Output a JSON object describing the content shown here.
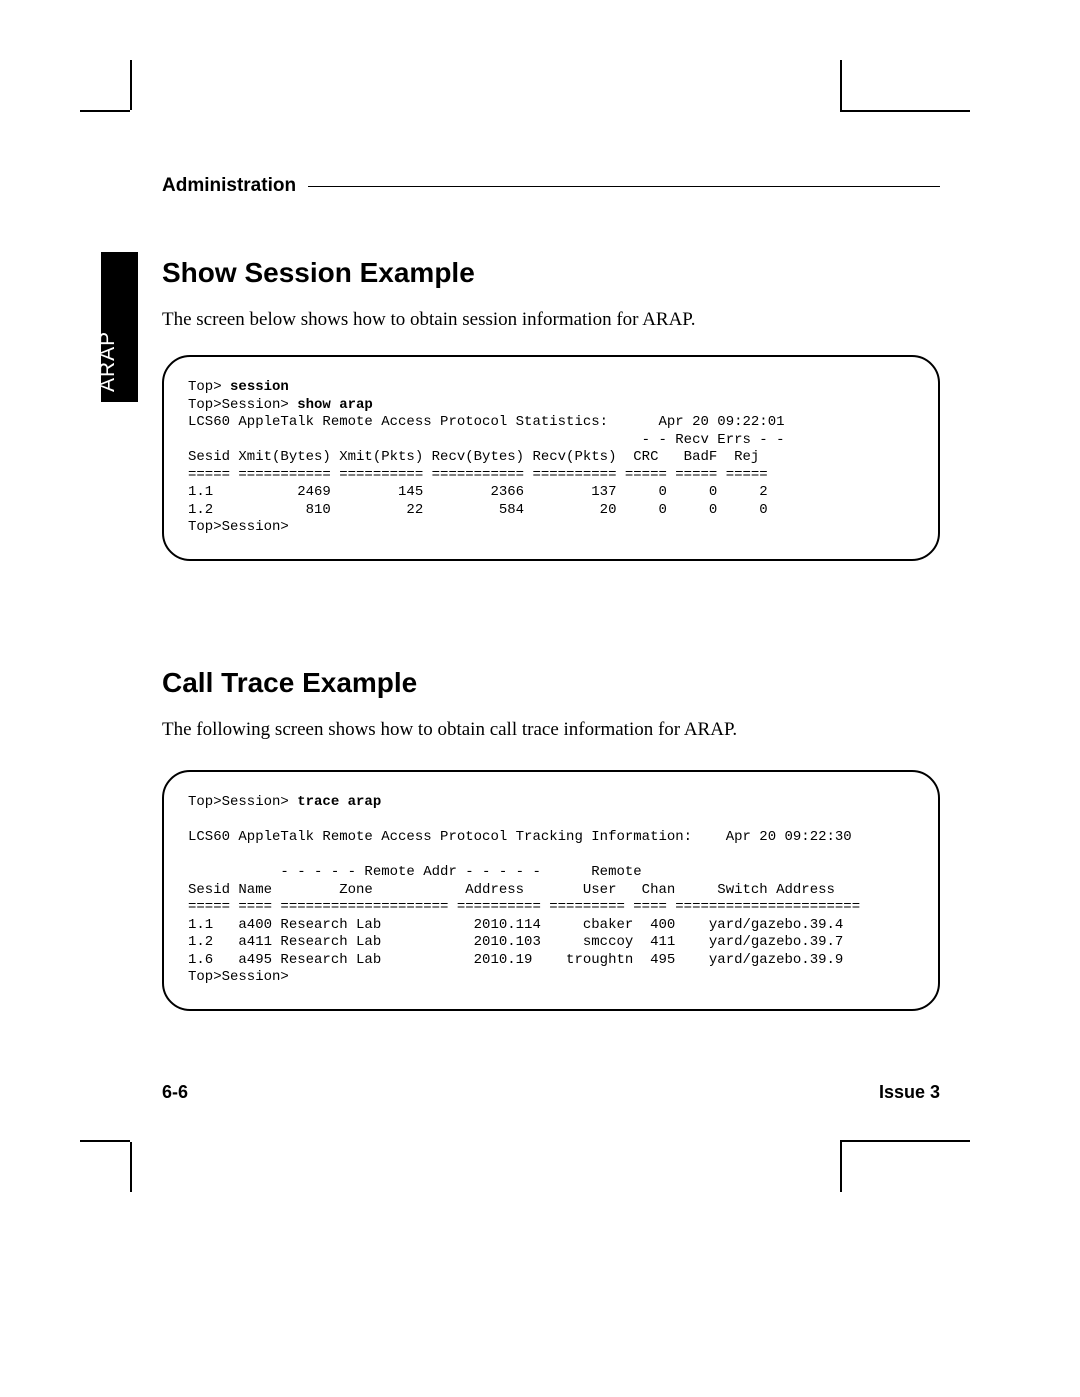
{
  "header": {
    "title": "Administration"
  },
  "side_tab": "ARAP",
  "section1": {
    "heading": "Show Session Example",
    "body": "The screen below shows how to obtain session information for ARAP."
  },
  "terminal1": {
    "prompt1": "Top> ",
    "cmd1": "session",
    "prompt2": "Top>Session> ",
    "cmd2": "show arap",
    "title_line": "LCS60 AppleTalk Remote Access Protocol Statistics:      Apr 20 09:22:01",
    "subhdr": "                                                      - - Recv Errs - -",
    "cols": "Sesid Xmit(Bytes) Xmit(Pkts) Recv(Bytes) Recv(Pkts)  CRC   BadF  Rej",
    "sep": "===== =========== ========== =========== ========== ===== ===== =====",
    "rows": [
      "1.1          2469        145        2366        137     0     0     2",
      "1.2           810         22         584         20     0     0     0"
    ],
    "tail": "Top>Session>"
  },
  "section2": {
    "heading": "Call Trace Example",
    "body": "The following screen shows how to obtain call trace information for ARAP."
  },
  "terminal2": {
    "prompt1": "Top>Session> ",
    "cmd1": "trace arap",
    "title_line": "LCS60 AppleTalk Remote Access Protocol Tracking Information:    Apr 20 09:22:30",
    "subhdr": "           - - - - - Remote Addr - - - - -      Remote",
    "cols": "Sesid Name        Zone           Address       User   Chan     Switch Address",
    "sep": "===== ==== ==================== ========== ========= ==== ======================",
    "rows": [
      "1.1   a400 Research Lab           2010.114     cbaker  400    yard/gazebo.39.4",
      "1.2   a411 Research Lab           2010.103     smccoy  411    yard/gazebo.39.7",
      "1.6   a495 Research Lab           2010.19    troughtn  495    yard/gazebo.39.9"
    ],
    "tail": "Top>Session>"
  },
  "footer": {
    "page": "6-6",
    "issue": "Issue 3"
  }
}
